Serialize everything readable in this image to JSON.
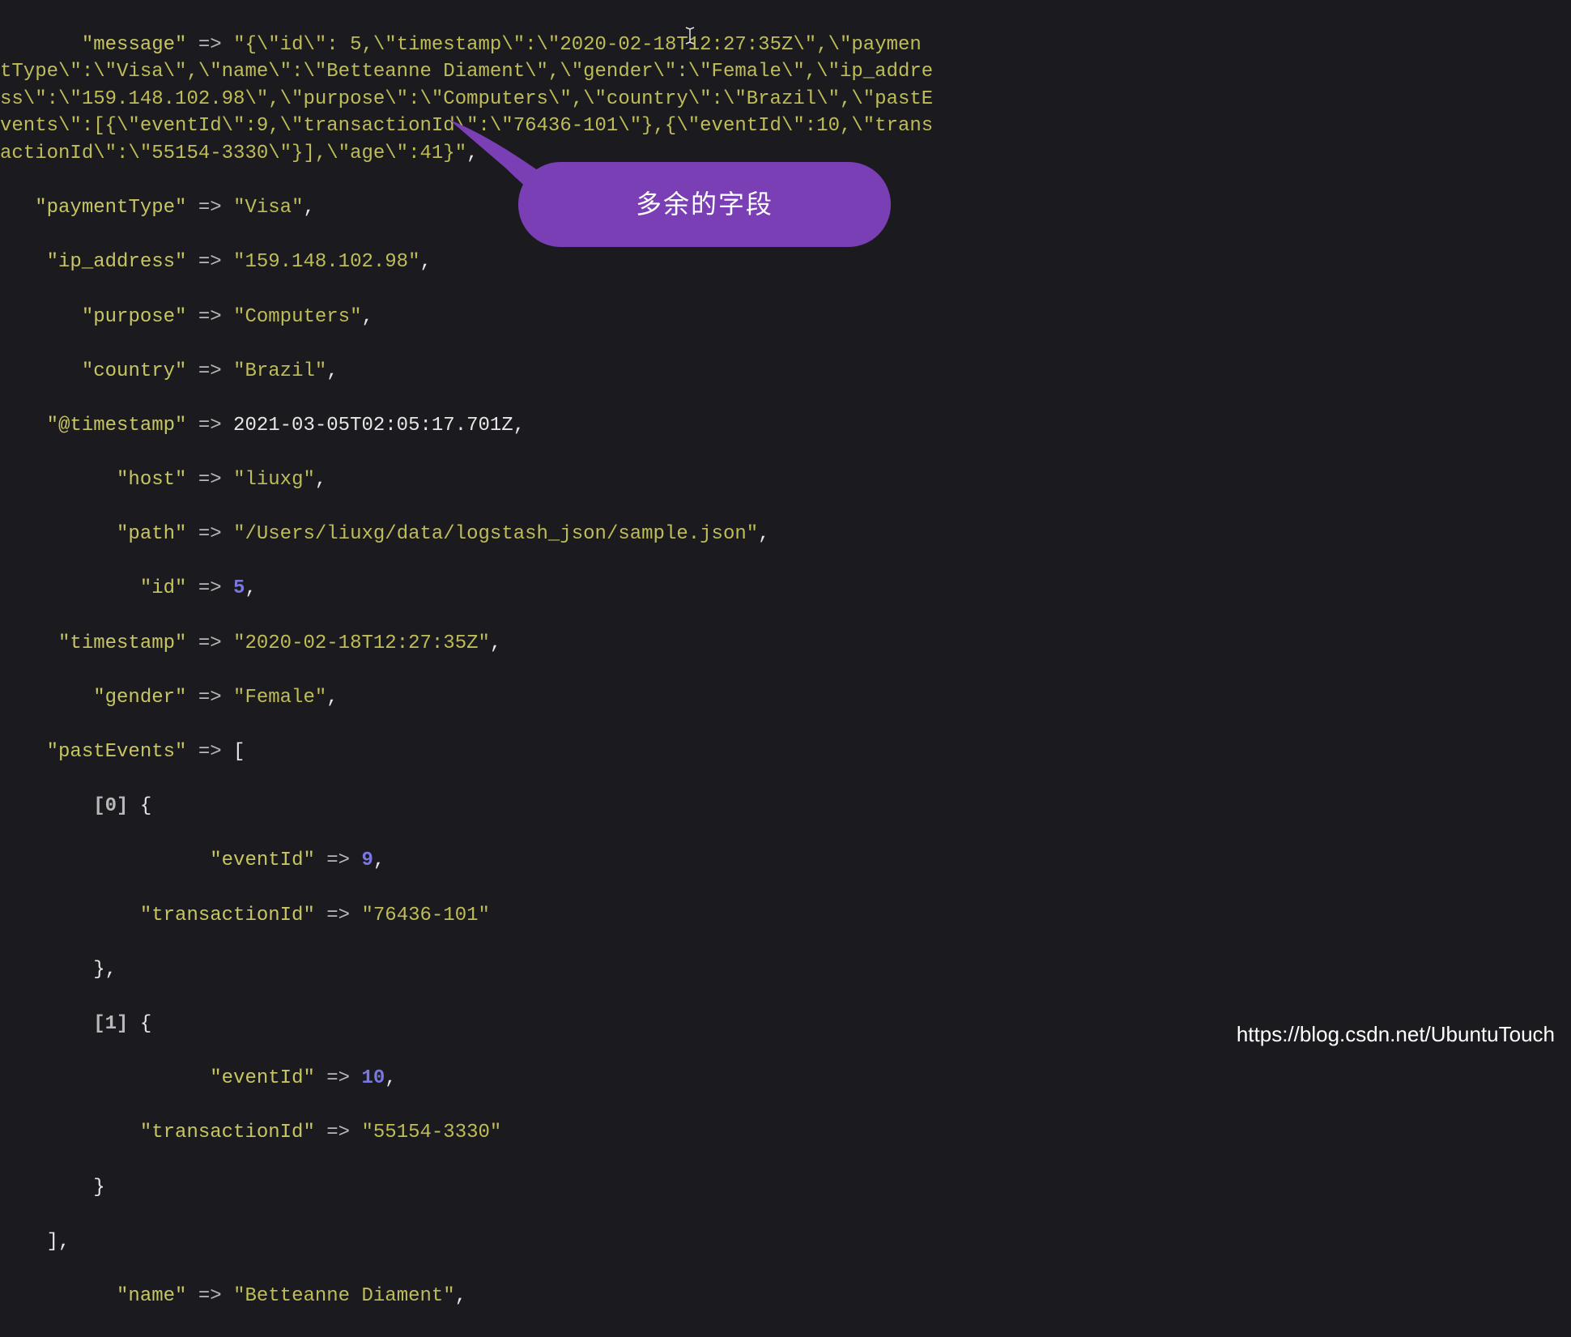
{
  "code": {
    "message_key": "\"message\"",
    "message_value": "\"{\\\"id\\\": 5,\\\"timestamp\\\":\\\"2020-02-18T12:27:35Z\\\",\\\"paymentType\\\":\\\"Visa\\\",\\\"name\\\":\\\"Betteanne Diament\\\",\\\"gender\\\":\\\"Female\\\",\\\"ip_address\\\":\\\"159.148.102.98\\\",\\\"purpose\\\":\\\"Computers\\\",\\\"country\\\":\\\"Brazil\\\",\\\"pastEvents\\\":[{\\\"eventId\\\":9,\\\"transactionId\\\":\\\"76436-101\\\"},{\\\"eventId\\\":10,\\\"transactionId\\\":\\\"55154-3330\\\"}],\\\"age\\\":41}\"",
    "paymentType_key": "\"paymentType\"",
    "paymentType_value": "\"Visa\"",
    "ip_address_key": "\"ip_address\"",
    "ip_address_value": "\"159.148.102.98\"",
    "purpose_key": "\"purpose\"",
    "purpose_value": "\"Computers\"",
    "country_key": "\"country\"",
    "country_value": "\"Brazil\"",
    "timestamp_at_key": "\"@timestamp\"",
    "timestamp_at_value": "2021-03-05T02:05:17.701Z",
    "host_key": "\"host\"",
    "host_value": "\"liuxg\"",
    "path_key": "\"path\"",
    "path_value": "\"/Users/liuxg/data/logstash_json/sample.json\"",
    "id_key": "\"id\"",
    "id_value": "5",
    "timestamp_key": "\"timestamp\"",
    "timestamp_value": "\"2020-02-18T12:27:35Z\"",
    "gender_key": "\"gender\"",
    "gender_value": "\"Female\"",
    "pastEvents_key": "\"pastEvents\"",
    "idx0": "[0]",
    "idx1": "[1]",
    "eventId_key": "\"eventId\"",
    "eventId_value_0": "9",
    "eventId_value_1": "10",
    "transactionId_key": "\"transactionId\"",
    "transactionId_value_0": "\"76436-101\"",
    "transactionId_value_1": "\"55154-3330\"",
    "name_key": "\"name\"",
    "name_value": "\"Betteanne Diament\"",
    "arrow": " => ",
    "comma": ","
  },
  "annotation": {
    "label": "多余的字段"
  },
  "cursor_char": "I",
  "watermark": "https://blog.csdn.net/UbuntuTouch"
}
